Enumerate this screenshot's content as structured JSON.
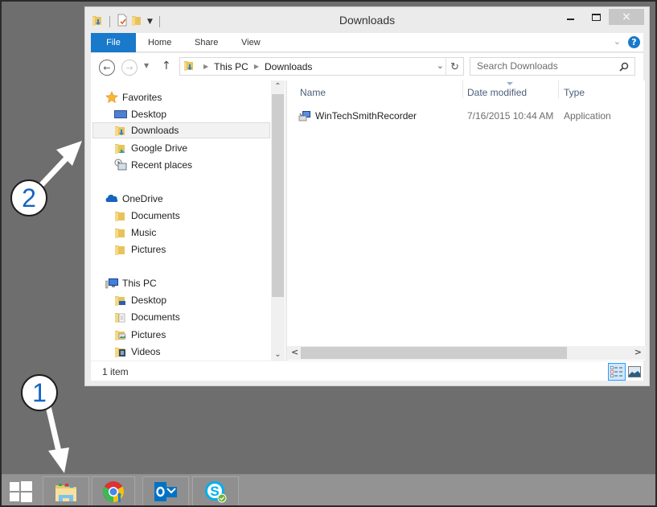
{
  "window": {
    "title": "Downloads",
    "minimize_label": "Minimize",
    "maximize_label": "Maximize",
    "close_label": "×"
  },
  "quick_access": {
    "icons": [
      "downloads-folder-icon",
      "properties-icon",
      "new-folder-icon",
      "customize-dropdown-icon"
    ]
  },
  "ribbon": {
    "tabs": [
      {
        "label": "File",
        "active": true
      },
      {
        "label": "Home"
      },
      {
        "label": "Share"
      },
      {
        "label": "View"
      }
    ],
    "expand_glyph": "⌄",
    "help_glyph": "?"
  },
  "navigation": {
    "back_glyph": "←",
    "forward_glyph": "→",
    "recent_glyph": "▼",
    "up_glyph": "↑",
    "breadcrumb": [
      "This PC",
      "Downloads"
    ],
    "address_dropdown_glyph": "⌄",
    "refresh_glyph": "↻",
    "search_placeholder": "Search Downloads",
    "search_glyph": "⚲"
  },
  "nav_pane": {
    "groups": [
      {
        "label": "Favorites",
        "icon": "star-icon",
        "items": [
          {
            "label": "Desktop",
            "icon": "desktop-icon"
          },
          {
            "label": "Downloads",
            "icon": "downloads-folder-icon",
            "selected": true
          },
          {
            "label": "Google Drive",
            "icon": "google-drive-folder-icon"
          },
          {
            "label": "Recent places",
            "icon": "recent-places-icon"
          }
        ]
      },
      {
        "label": "OneDrive",
        "icon": "onedrive-cloud-icon",
        "items": [
          {
            "label": "Documents",
            "icon": "folder-icon"
          },
          {
            "label": "Music",
            "icon": "folder-icon"
          },
          {
            "label": "Pictures",
            "icon": "folder-icon"
          }
        ]
      },
      {
        "label": "This PC",
        "icon": "computer-icon",
        "items": [
          {
            "label": "Desktop",
            "icon": "desktop-folder-icon"
          },
          {
            "label": "Documents",
            "icon": "documents-folder-icon"
          },
          {
            "label": "Pictures",
            "icon": "pictures-folder-icon"
          },
          {
            "label": "Videos",
            "icon": "videos-folder-icon"
          }
        ]
      }
    ],
    "scroll_up_glyph": "⌃",
    "scroll_down_glyph": "⌄"
  },
  "file_list": {
    "columns": [
      "Name",
      "Date modified",
      "Type"
    ],
    "sorted_column": "Date modified",
    "rows": [
      {
        "name": "WinTechSmithRecorder",
        "date_modified": "7/16/2015 10:44 AM",
        "type": "Application",
        "icon": "application-installer-icon"
      }
    ],
    "scroll_left_glyph": "<",
    "scroll_right_glyph": ">"
  },
  "status_bar": {
    "item_count": "1 item",
    "views": [
      {
        "name": "details-view",
        "active": true
      },
      {
        "name": "large-icons-view",
        "active": false
      }
    ]
  },
  "taskbar": {
    "items": [
      {
        "name": "start-button",
        "label": "Start"
      },
      {
        "name": "file-explorer",
        "label": "File Explorer"
      },
      {
        "name": "chrome",
        "label": "Google Chrome"
      },
      {
        "name": "outlook",
        "label": "Outlook"
      },
      {
        "name": "skype",
        "label": "Skype"
      }
    ]
  },
  "annotations": [
    {
      "number": "1",
      "target": "taskbar file explorer button"
    },
    {
      "number": "2",
      "target": "Downloads in navigation pane"
    }
  ],
  "colors": {
    "accent": "#1979ca",
    "desktop_bg": "#6e6e6e",
    "taskbar_bg": "#939393",
    "callout_text": "#1565c0"
  }
}
